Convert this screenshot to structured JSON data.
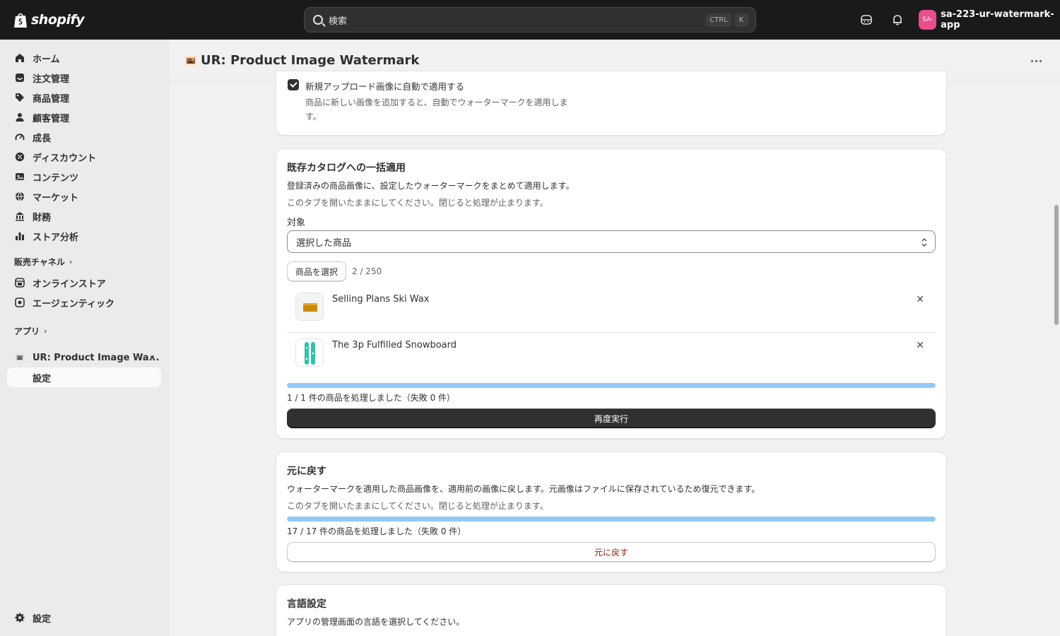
{
  "topbar": {
    "brand": "shopify",
    "search_placeholder": "検索",
    "shortcut_ctrl": "CTRL",
    "shortcut_key": "K",
    "store_avatar": "SA-",
    "store_name": "sa-223-ur-watermark-app"
  },
  "sidebar": {
    "items": [
      {
        "label": "ホーム",
        "icon": "home-icon"
      },
      {
        "label": "注文管理",
        "icon": "inbox-icon"
      },
      {
        "label": "商品管理",
        "icon": "tag-icon"
      },
      {
        "label": "顧客管理",
        "icon": "person-icon"
      },
      {
        "label": "成長",
        "icon": "gauge-icon"
      },
      {
        "label": "ディスカウント",
        "icon": "discount-icon"
      },
      {
        "label": "コンテンツ",
        "icon": "content-icon"
      },
      {
        "label": "マーケット",
        "icon": "globe-icon"
      },
      {
        "label": "財務",
        "icon": "bank-icon"
      },
      {
        "label": "ストア分析",
        "icon": "bar-chart-icon"
      }
    ],
    "sales_channels_label": "販売チャネル",
    "channels": [
      {
        "label": "オンラインストア",
        "icon": "store-icon"
      },
      {
        "label": "エージェンティック",
        "icon": "agentic-icon"
      }
    ],
    "apps_label": "アプリ",
    "app_item": "UR: Product Image Wa...",
    "app_sub_item": "設定",
    "settings_label": "設定"
  },
  "header": {
    "title": "UR: Product Image Watermark"
  },
  "auto_apply": {
    "checkbox_label": "新規アップロード画像に自動で適用する",
    "help_line1": "商品に新しい画像を追加すると、自動でウォーターマークを適用しま",
    "help_line2": "す。",
    "checked": true
  },
  "bulk": {
    "title": "既存カタログへの一括適用",
    "description": "登録済みの商品画像に、設定したウォーターマークをまとめて適用します。",
    "warning": "このタブを開いたままにしてください。閉じると処理が止まります。",
    "target_label": "対象",
    "target_value": "選択した商品",
    "select_products_button": "商品を選択",
    "selected_count": "2 / 250",
    "products": [
      {
        "name": "Selling Plans Ski Wax",
        "thumb_color": "#c88a0e"
      },
      {
        "name": "The 3p Fulfilled Snowboard",
        "thumb_color": "#2ec4a6"
      }
    ],
    "progress": 1.0,
    "status": "1 / 1 件の商品を処理しました（失敗 0 件）",
    "rerun_button": "再度実行"
  },
  "revert": {
    "title": "元に戻す",
    "description": "ウォーターマークを適用した商品画像を、適用前の画像に戻します。元画像はファイルに保存されているため復元できます。",
    "warning": "このタブを開いたままにしてください。閉じると処理が止まります。",
    "progress": 1.0,
    "status": "17 / 17 件の商品を処理しました（失敗 0 件）",
    "revert_button": "元に戻す"
  },
  "language": {
    "title": "言語設定",
    "description": "アプリの管理画面の言語を選択してください。"
  },
  "colors": {
    "accent_progress": "#93c8f6",
    "primary_button": "#303030",
    "danger_text": "#8e1f0b",
    "avatar": "#e94d8a"
  }
}
